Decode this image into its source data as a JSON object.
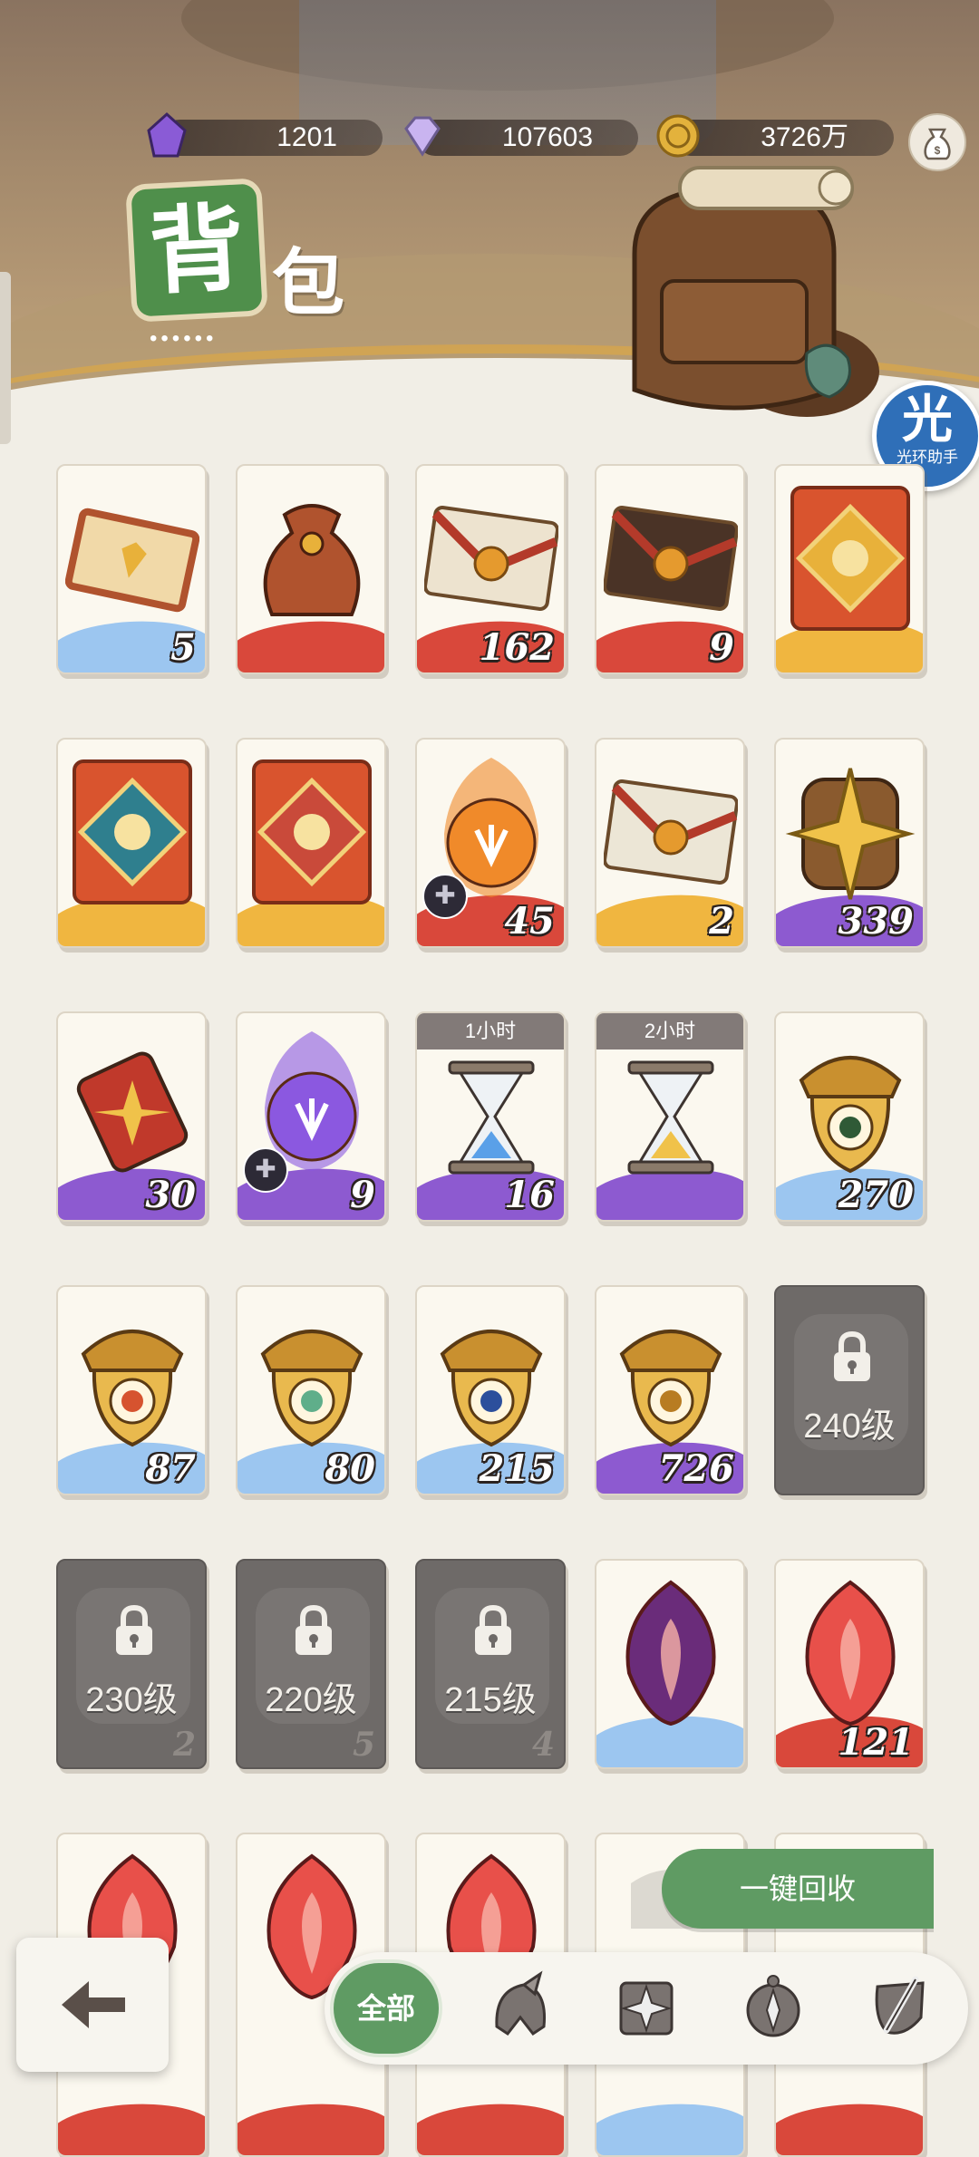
{
  "currencies": [
    {
      "name": "purple-crystal-icon",
      "value": "1201",
      "color": "#8a5bd6"
    },
    {
      "name": "diamond-icon",
      "value": "107603",
      "color": "#c9b4f0"
    },
    {
      "name": "gold-coin-icon",
      "value": "3726万",
      "color": "#e3b23c"
    }
  ],
  "title": {
    "first": "背",
    "second": "包",
    "dots": "••••••"
  },
  "assistant": {
    "glyph": "光",
    "label": "光环助手"
  },
  "items": [
    {
      "qty": "5",
      "icon": "ticket-icon",
      "stripe": "#9cc6f0"
    },
    {
      "qty": "",
      "icon": "pouch-icon",
      "stripe": "#d9483b"
    },
    {
      "qty": "162",
      "icon": "red-envelope-icon",
      "stripe": "#d9483b"
    },
    {
      "qty": "9",
      "icon": "dark-envelope-icon",
      "stripe": "#d9483b"
    },
    {
      "qty": "",
      "icon": "coin-card-icon",
      "stripe": "#f0b640"
    },
    {
      "qty": "",
      "icon": "fox-card-icon",
      "stripe": "#f0b640"
    },
    {
      "qty": "",
      "icon": "girl-card-icon",
      "stripe": "#f0b640"
    },
    {
      "qty": "45",
      "icon": "fire-orb-icon",
      "stripe": "#d9483b",
      "puzzle": true
    },
    {
      "qty": "2",
      "icon": "letter-icon",
      "stripe": "#f0b640"
    },
    {
      "qty": "339",
      "icon": "star-emblem-icon",
      "stripe": "#8d5ad0"
    },
    {
      "qty": "30",
      "icon": "scroll-icon",
      "stripe": "#8d5ad0"
    },
    {
      "qty": "9",
      "icon": "purple-orb-icon",
      "stripe": "#8d5ad0",
      "puzzle": true
    },
    {
      "qty": "16",
      "icon": "hourglass-icon",
      "stripe": "#8d5ad0",
      "time": "1小时"
    },
    {
      "qty": "",
      "icon": "hourglass-gold-icon",
      "stripe": "#8d5ad0",
      "time": "2小时"
    },
    {
      "qty": "270",
      "icon": "acorn-eye-icon",
      "stripe": "#9cc6f0"
    },
    {
      "qty": "87",
      "icon": "acorn-target-icon",
      "stripe": "#9cc6f0"
    },
    {
      "qty": "80",
      "icon": "acorn-leaf-icon",
      "stripe": "#9cc6f0"
    },
    {
      "qty": "215",
      "icon": "acorn-star-icon",
      "stripe": "#9cc6f0"
    },
    {
      "qty": "726",
      "icon": "acorn-diamond-icon",
      "stripe": "#8d5ad0"
    },
    {
      "qty": "",
      "icon": "lock-icon",
      "locked": true,
      "lock_text": "240级"
    },
    {
      "qty": "2",
      "icon": "lock-icon",
      "locked": true,
      "lock_text": "230级"
    },
    {
      "qty": "5",
      "icon": "lock-icon",
      "locked": true,
      "lock_text": "220级"
    },
    {
      "qty": "4",
      "icon": "lock-icon",
      "locked": true,
      "lock_text": "215级"
    },
    {
      "qty": "",
      "icon": "dark-gem-icon",
      "stripe": "#9cc6f0"
    },
    {
      "qty": "121",
      "icon": "red-gem-icon",
      "stripe": "#d9483b"
    },
    {
      "qty": "",
      "icon": "shield-gem-icon",
      "stripe": "#d9483b"
    },
    {
      "qty": "",
      "icon": "shield-gem-icon",
      "stripe": "#d9483b"
    },
    {
      "qty": "",
      "icon": "shield-gem-icon",
      "stripe": "#d9483b"
    },
    {
      "qty": "",
      "icon": "partial-item-icon",
      "stripe": "#9cc6f0"
    },
    {
      "qty": "",
      "icon": "partial-item-icon",
      "stripe": "#d9483b"
    }
  ],
  "recycle_label": "一键回收",
  "tabs": {
    "all_label": "全部",
    "icons": [
      "helmet-icon",
      "compass-star-icon",
      "compass-icon",
      "sword-shield-icon"
    ]
  },
  "colors": {
    "accent": "#5f9b63",
    "background": "#f1eee6"
  }
}
